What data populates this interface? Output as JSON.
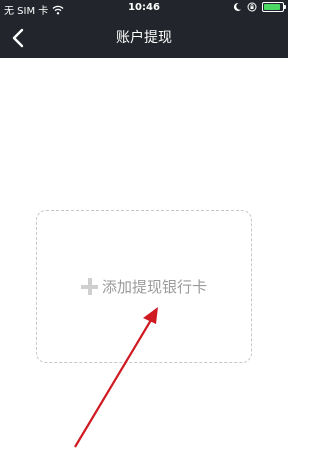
{
  "status_bar": {
    "carrier": "无 SIM 卡",
    "time": "10:46",
    "battery_level": 0.9,
    "battery_color": "#4cd964"
  },
  "nav": {
    "back_icon": "chevron-left-icon",
    "title": "账户提现"
  },
  "add_card": {
    "icon": "plus-icon",
    "label": "添加提现银行卡"
  },
  "annotation": {
    "arrow_color": "#d01a22"
  }
}
